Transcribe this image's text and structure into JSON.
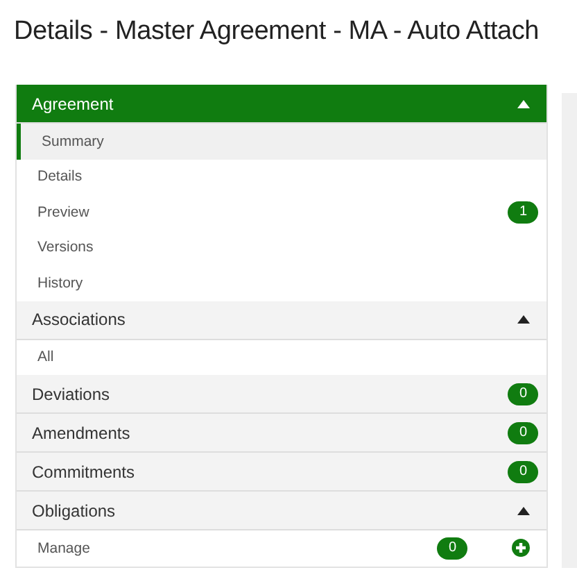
{
  "title": "Details - Master Agreement - MA - Auto Attach",
  "sections": [
    {
      "label": "Agreement",
      "active": true,
      "expanded": true,
      "items": [
        {
          "label": "Summary",
          "selected": true
        },
        {
          "label": "Details",
          "selected": false
        },
        {
          "label": "Preview",
          "selected": false,
          "badge": "1"
        },
        {
          "label": "Versions",
          "selected": false
        },
        {
          "label": "History",
          "selected": false
        }
      ]
    },
    {
      "label": "Associations",
      "active": false,
      "expanded": true,
      "items": [
        {
          "label": "All",
          "selected": false
        }
      ]
    },
    {
      "label": "Deviations",
      "active": false,
      "expanded": false,
      "badge": "0"
    },
    {
      "label": "Amendments",
      "active": false,
      "expanded": false,
      "badge": "0"
    },
    {
      "label": "Commitments",
      "active": false,
      "expanded": false,
      "badge": "0"
    },
    {
      "label": "Obligations",
      "active": false,
      "expanded": true,
      "items": [
        {
          "label": "Manage",
          "selected": false,
          "badge": "0",
          "add": true
        }
      ]
    }
  ]
}
